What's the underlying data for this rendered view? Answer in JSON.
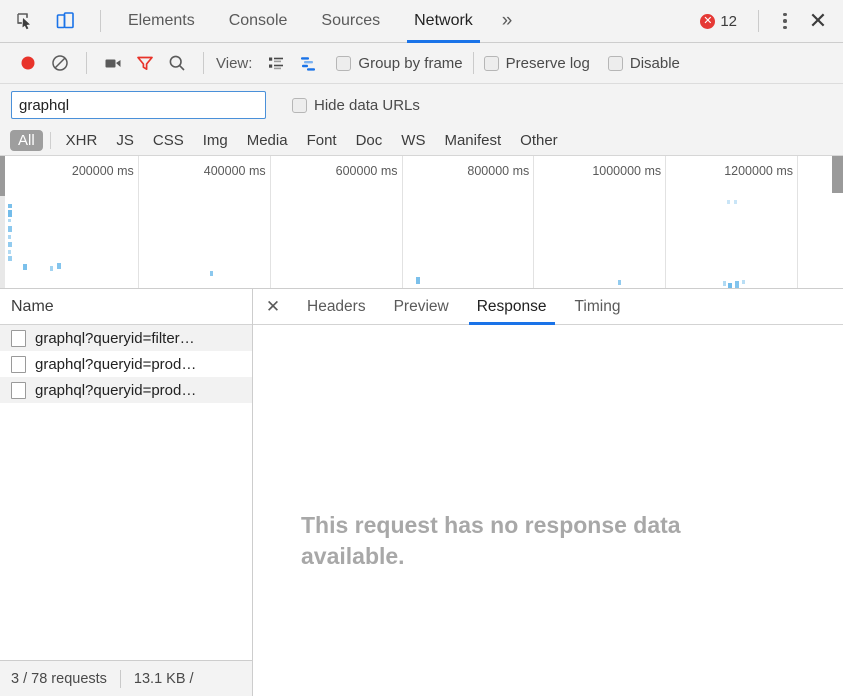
{
  "window": {
    "tabbar": {
      "inspect_icon": "inspect-element-icon",
      "device_icon": "device-toolbar-icon",
      "tabs": [
        {
          "label": "Elements",
          "active": false
        },
        {
          "label": "Console",
          "active": false
        },
        {
          "label": "Sources",
          "active": false
        },
        {
          "label": "Network",
          "active": true
        }
      ],
      "more_tabs_label": "»",
      "error_count": "12",
      "error_icon": "error-circle-icon",
      "menu_icon": "kebab-menu-icon",
      "close_label": "✕"
    }
  },
  "toolbar": {
    "record_icon": "record-button-icon",
    "clear_icon": "clear-network-log-icon",
    "screenshot_icon": "capture-screenshots-icon",
    "filter_icon": "filter-icon",
    "search_icon": "search-icon",
    "view_label": "View:",
    "list_view_icon": "list-view-icon",
    "waterfall_view_icon": "waterfall-view-icon",
    "group_by_frame": {
      "label": "Group by frame",
      "checked": false
    },
    "preserve_log": {
      "label": "Preserve log",
      "checked": false
    },
    "disable_cache": {
      "label": "Disable",
      "checked": false
    }
  },
  "filter": {
    "value": "graphql",
    "placeholder": "Filter",
    "hide_data_urls": {
      "label": "Hide data URLs",
      "checked": false
    },
    "types": [
      {
        "label": "All",
        "active": true
      },
      {
        "label": "XHR",
        "active": false
      },
      {
        "label": "JS",
        "active": false
      },
      {
        "label": "CSS",
        "active": false
      },
      {
        "label": "Img",
        "active": false
      },
      {
        "label": "Media",
        "active": false
      },
      {
        "label": "Font",
        "active": false
      },
      {
        "label": "Doc",
        "active": false
      },
      {
        "label": "WS",
        "active": false
      },
      {
        "label": "Manifest",
        "active": false
      },
      {
        "label": "Other",
        "active": false
      }
    ]
  },
  "overview": {
    "ticks": [
      {
        "label": "200000 ms",
        "pct": 16.66
      },
      {
        "label": "400000 ms",
        "pct": 33.33
      },
      {
        "label": "600000 ms",
        "pct": 50.0
      },
      {
        "label": "800000 ms",
        "pct": 66.66
      },
      {
        "label": "1000000 ms",
        "pct": 83.33
      },
      {
        "label": "1200000 ms",
        "pct": 100.0
      }
    ],
    "bar_color": "#64b5e8",
    "bars": [
      {
        "xpct": 0.2,
        "ypct": 36,
        "w": 4,
        "h": 4,
        "o": 0.85
      },
      {
        "xpct": 0.2,
        "ypct": 41,
        "w": 4,
        "h": 7,
        "o": 0.9
      },
      {
        "xpct": 0.3,
        "ypct": 48,
        "w": 3,
        "h": 3,
        "o": 0.5
      },
      {
        "xpct": 0.2,
        "ypct": 53,
        "w": 4,
        "h": 6,
        "o": 0.75
      },
      {
        "xpct": 0.3,
        "ypct": 60,
        "w": 3,
        "h": 4,
        "o": 0.55
      },
      {
        "xpct": 0.2,
        "ypct": 65,
        "w": 4,
        "h": 5,
        "o": 0.7
      },
      {
        "xpct": 0.3,
        "ypct": 71,
        "w": 3,
        "h": 4,
        "o": 0.5
      },
      {
        "xpct": 0.2,
        "ypct": 76,
        "w": 4,
        "h": 5,
        "o": 0.65
      },
      {
        "xpct": 2.1,
        "ypct": 82,
        "w": 4,
        "h": 6,
        "o": 0.85
      },
      {
        "xpct": 5.6,
        "ypct": 83,
        "w": 3,
        "h": 5,
        "o": 0.6
      },
      {
        "xpct": 6.4,
        "ypct": 81,
        "w": 4,
        "h": 6,
        "o": 0.8
      },
      {
        "xpct": 25.8,
        "ypct": 87,
        "w": 3,
        "h": 5,
        "o": 0.75
      },
      {
        "xpct": 51.8,
        "ypct": 92,
        "w": 4,
        "h": 7,
        "o": 0.85
      },
      {
        "xpct": 77.4,
        "ypct": 94,
        "w": 3,
        "h": 5,
        "o": 0.7
      },
      {
        "xpct": 91.1,
        "ypct": 33,
        "w": 3,
        "h": 4,
        "o": 0.35
      },
      {
        "xpct": 92.0,
        "ypct": 33,
        "w": 3,
        "h": 4,
        "o": 0.35
      },
      {
        "xpct": 90.6,
        "ypct": 95,
        "w": 3,
        "h": 5,
        "o": 0.5
      },
      {
        "xpct": 91.3,
        "ypct": 96,
        "w": 4,
        "h": 8,
        "o": 0.9
      },
      {
        "xpct": 92.2,
        "ypct": 95,
        "w": 4,
        "h": 7,
        "o": 0.8
      },
      {
        "xpct": 93.0,
        "ypct": 94,
        "w": 3,
        "h": 4,
        "o": 0.45
      }
    ]
  },
  "requests": {
    "column_name": "Name",
    "rows": [
      {
        "name": "graphql?queryid=filter…",
        "icon": "document-icon"
      },
      {
        "name": "graphql?queryid=prod…",
        "icon": "document-icon"
      },
      {
        "name": "graphql?queryid=prod…",
        "icon": "document-icon"
      }
    ],
    "status": {
      "requests": "3 / 78 requests",
      "transferred": "13.1 KB /"
    }
  },
  "details": {
    "close_label": "✕",
    "tabs": [
      {
        "label": "Headers",
        "active": false
      },
      {
        "label": "Preview",
        "active": false
      },
      {
        "label": "Response",
        "active": true
      },
      {
        "label": "Timing",
        "active": false
      }
    ],
    "empty_message": "This request has no response data available."
  }
}
